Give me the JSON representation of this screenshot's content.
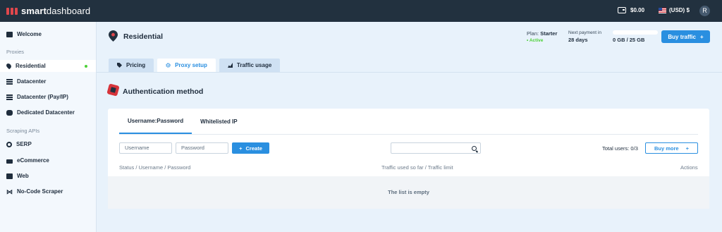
{
  "topbar": {
    "brand_bold": "smart",
    "brand_thin": "dashboard",
    "balance": "$0.00",
    "currency": "(USD) $",
    "avatar_initial": "R"
  },
  "sidebar": {
    "welcome": "Welcome",
    "section_proxies": "Proxies",
    "residential": "Residential",
    "datacenter": "Datacenter",
    "datacenter_payip": "Datacenter (Pay/IP)",
    "dedicated_datacenter": "Dedicated Datacenter",
    "section_scraping": "Scraping APIs",
    "serp": "SERP",
    "ecommerce": "eCommerce",
    "web": "Web",
    "nocode": "No-Code Scraper",
    "active_item": "Residential"
  },
  "header": {
    "title": "Residential",
    "plan_label": "Plan:",
    "plan_name": "Starter",
    "plan_status": "• Active",
    "next_payment_label": "Next payment in",
    "next_payment_value": "28 days",
    "traffic_used_fraction": 0,
    "traffic_text": "0 GB / 25 GB",
    "buy_traffic_label": "Buy traffic",
    "buy_traffic_plus": "+"
  },
  "tabs": {
    "pricing": "Pricing",
    "proxy_setup": "Proxy setup",
    "traffic_usage": "Traffic usage",
    "active": "Proxy setup"
  },
  "auth": {
    "title": "Authentication method",
    "subtab_userpass": "Username:Password",
    "subtab_whitelisted": "Whitelisted IP",
    "username_placeholder": "Username",
    "password_placeholder": "Password",
    "create_label": "Create",
    "create_plus": "+",
    "search_placeholder": "",
    "total_users": "Total users: 0/3",
    "buy_more_label": "Buy more",
    "buy_more_plus": "+",
    "col_status": "Status / Username / Password",
    "col_traffic": "Traffic used so far / Traffic limit",
    "col_actions": "Actions",
    "empty_text": "The list is empty"
  },
  "colors": {
    "topbar": "#22313f",
    "accent": "#2a8fe0",
    "active_green": "#4cd137",
    "brand_red": "#e0474c"
  }
}
